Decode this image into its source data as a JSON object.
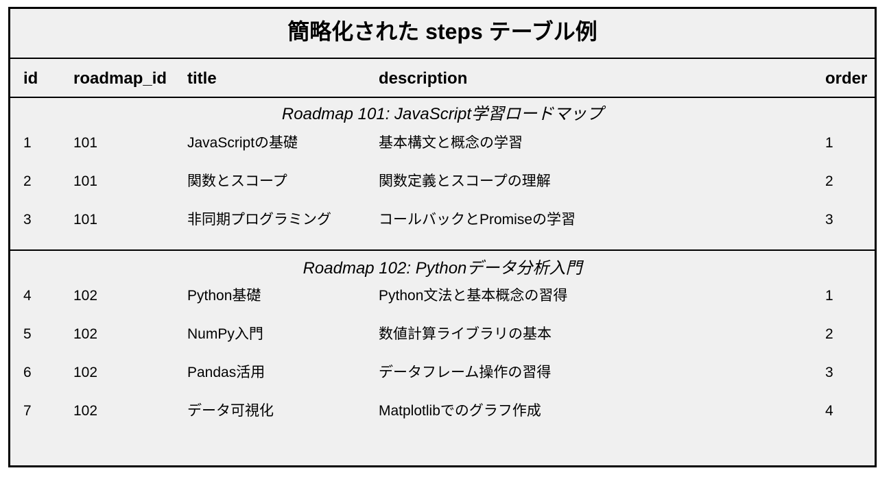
{
  "title": "簡略化された steps テーブル例",
  "columns": {
    "id": "id",
    "roadmap_id": "roadmap_id",
    "title": "title",
    "description": "description",
    "order": "order"
  },
  "groups": [
    {
      "caption": "Roadmap 101: JavaScript学習ロードマップ",
      "rows": [
        {
          "id": "1",
          "roadmap_id": "101",
          "title": "JavaScriptの基礎",
          "description": "基本構文と概念の学習",
          "order": "1"
        },
        {
          "id": "2",
          "roadmap_id": "101",
          "title": "関数とスコープ",
          "description": "関数定義とスコープの理解",
          "order": "2"
        },
        {
          "id": "3",
          "roadmap_id": "101",
          "title": "非同期プログラミング",
          "description": "コールバックとPromiseの学習",
          "order": "3"
        }
      ]
    },
    {
      "caption": "Roadmap 102: Pythonデータ分析入門",
      "rows": [
        {
          "id": "4",
          "roadmap_id": "102",
          "title": "Python基礎",
          "description": "Python文法と基本概念の習得",
          "order": "1"
        },
        {
          "id": "5",
          "roadmap_id": "102",
          "title": "NumPy入門",
          "description": "数値計算ライブラリの基本",
          "order": "2"
        },
        {
          "id": "6",
          "roadmap_id": "102",
          "title": "Pandas活用",
          "description": "データフレーム操作の習得",
          "order": "3"
        },
        {
          "id": "7",
          "roadmap_id": "102",
          "title": "データ可視化",
          "description": "Matplotlibでのグラフ作成",
          "order": "4"
        }
      ]
    }
  ]
}
